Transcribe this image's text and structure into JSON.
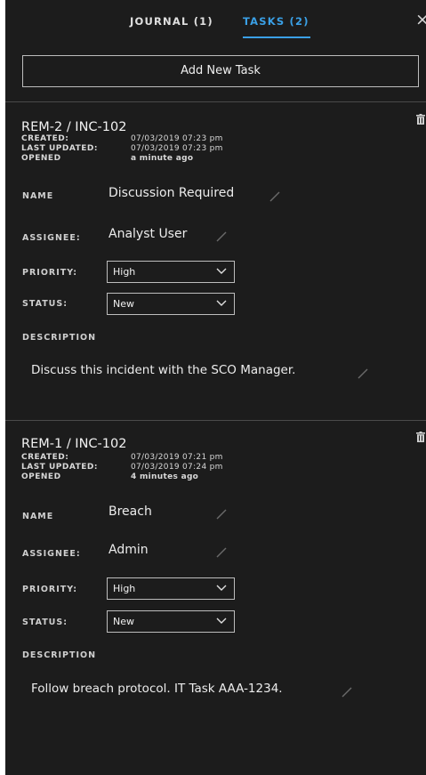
{
  "tabs": {
    "journal": "JOURNAL (1)",
    "tasks": "TASKS (2)"
  },
  "close_glyph": "×",
  "add_button": "Add New Task",
  "labels": {
    "created": "CREATED:",
    "last_updated": "LAST UPDATED:",
    "opened": "OPENED",
    "name": "NAME",
    "assignee": "ASSIGNEE:",
    "priority": "PRIORITY:",
    "status": "STATUS:",
    "description": "DESCRIPTION"
  },
  "tasks": [
    {
      "title": "REM-2 / INC-102",
      "created": "07/03/2019 07:23 pm",
      "last_updated": "07/03/2019 07:23 pm",
      "opened": "a minute ago",
      "name": "Discussion Required",
      "assignee": "Analyst User",
      "priority": "High",
      "status": "New",
      "description": "Discuss this incident with the SCO Manager."
    },
    {
      "title": "REM-1 / INC-102",
      "created": "07/03/2019 07:21 pm",
      "last_updated": "07/03/2019 07:24 pm",
      "opened": "4 minutes ago",
      "name": "Breach",
      "assignee": "Admin",
      "priority": "High",
      "status": "New",
      "description": "Follow breach protocol. IT Task AAA-1234."
    }
  ],
  "icons": {
    "close": "close-icon",
    "edit": "pencil-icon",
    "delete": "trash-icon",
    "dropdown": "chevron-down-icon"
  },
  "colors": {
    "panel_bg": "#1c1c1c",
    "accent": "#3aa0e6"
  }
}
